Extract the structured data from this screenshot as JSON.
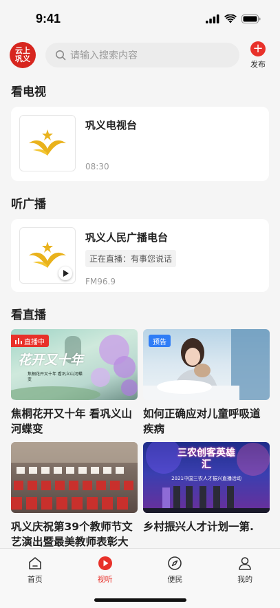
{
  "status": {
    "time": "9:41"
  },
  "header": {
    "logo_text": "云上巩义",
    "search_placeholder": "请输入搜索内容",
    "publish_label": "发布"
  },
  "tv": {
    "section_title": "看电视",
    "channel_name": "巩义电视台",
    "time": "08:30"
  },
  "radio": {
    "section_title": "听广播",
    "station_name": "巩义人民广播电台",
    "now_playing": "正在直播：有事您说话",
    "frequency": "FM96.9"
  },
  "live": {
    "section_title": "看直播",
    "items": [
      {
        "badge": "直播中",
        "title": "焦桐花开又十年 看巩义山河蝶变",
        "image_text": "花开又十年",
        "image_caption": "焦桐花开又十年 看巩义山河蝶变"
      },
      {
        "badge": "预告",
        "title": "如何正确应对儿童呼吸道疾病"
      },
      {
        "title": "巩义庆祝第39个教师节文艺演出暨最美教师表彰大"
      },
      {
        "title": "乡村振兴人才计划一第.",
        "image_text": "三农创客英雄汇",
        "image_caption": "2021中国三农人才振兴直播活动"
      }
    ]
  },
  "tabbar": {
    "tabs": [
      {
        "label": "首页"
      },
      {
        "label": "视听"
      },
      {
        "label": "便民"
      },
      {
        "label": "我的"
      }
    ]
  },
  "colors": {
    "accent": "#e8312a",
    "preview_badge": "#2f7df6"
  }
}
